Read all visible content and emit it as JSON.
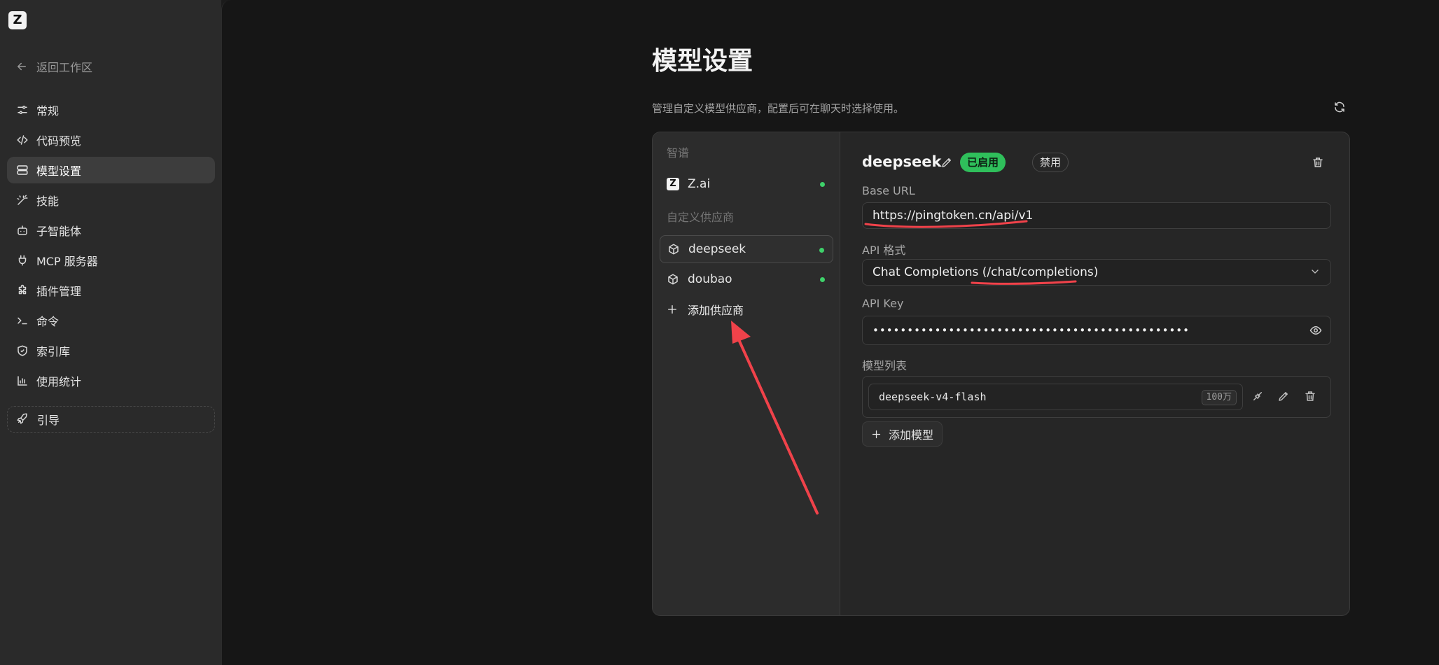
{
  "app": {
    "logo_letter": "Z"
  },
  "sidebar": {
    "back_label": "返回工作区",
    "items": [
      {
        "label": "常规",
        "icon": "sliders-icon"
      },
      {
        "label": "代码预览",
        "icon": "code-icon"
      },
      {
        "label": "模型设置",
        "icon": "server-icon",
        "active": true
      },
      {
        "label": "技能",
        "icon": "magic-wand-icon"
      },
      {
        "label": "子智能体",
        "icon": "robot-icon"
      },
      {
        "label": "MCP 服务器",
        "icon": "plug-icon"
      },
      {
        "label": "插件管理",
        "icon": "puzzle-icon"
      },
      {
        "label": "命令",
        "icon": "terminal-icon"
      },
      {
        "label": "索引库",
        "icon": "shield-icon"
      },
      {
        "label": "使用统计",
        "icon": "bar-chart-icon"
      }
    ],
    "guide_label": "引导"
  },
  "page": {
    "title": "模型设置",
    "subtitle": "管理自定义模型供应商，配置后可在聊天时选择使用。"
  },
  "providers": {
    "group_builtin": "智谱",
    "builtin": [
      {
        "name": "Z.ai",
        "icon_letter": "Z",
        "status": "enabled"
      }
    ],
    "group_custom": "自定义供应商",
    "custom": [
      {
        "name": "deepseek",
        "status": "enabled",
        "selected": true
      },
      {
        "name": "doubao",
        "status": "enabled"
      }
    ],
    "add_label": "添加供应商"
  },
  "detail": {
    "name": "deepseek",
    "enabled_badge": "已启用",
    "disable_label": "禁用",
    "base_url_label": "Base URL",
    "base_url_value": "https://pingtoken.cn/api/v1",
    "api_format_label": "API 格式",
    "api_format_value": "Chat Completions (/chat/completions)",
    "api_key_label": "API Key",
    "api_key_masked": "••••••••••••••••••••••••••••••••••••••••••••••",
    "models_label": "模型列表",
    "models": [
      {
        "id": "deepseek-v4-flash",
        "context": "100万"
      }
    ],
    "add_model_label": "添加模型"
  },
  "colors": {
    "accent_green": "#2fbf5b",
    "status_dot": "#3ed16a",
    "annotation_red": "#f0424a"
  }
}
